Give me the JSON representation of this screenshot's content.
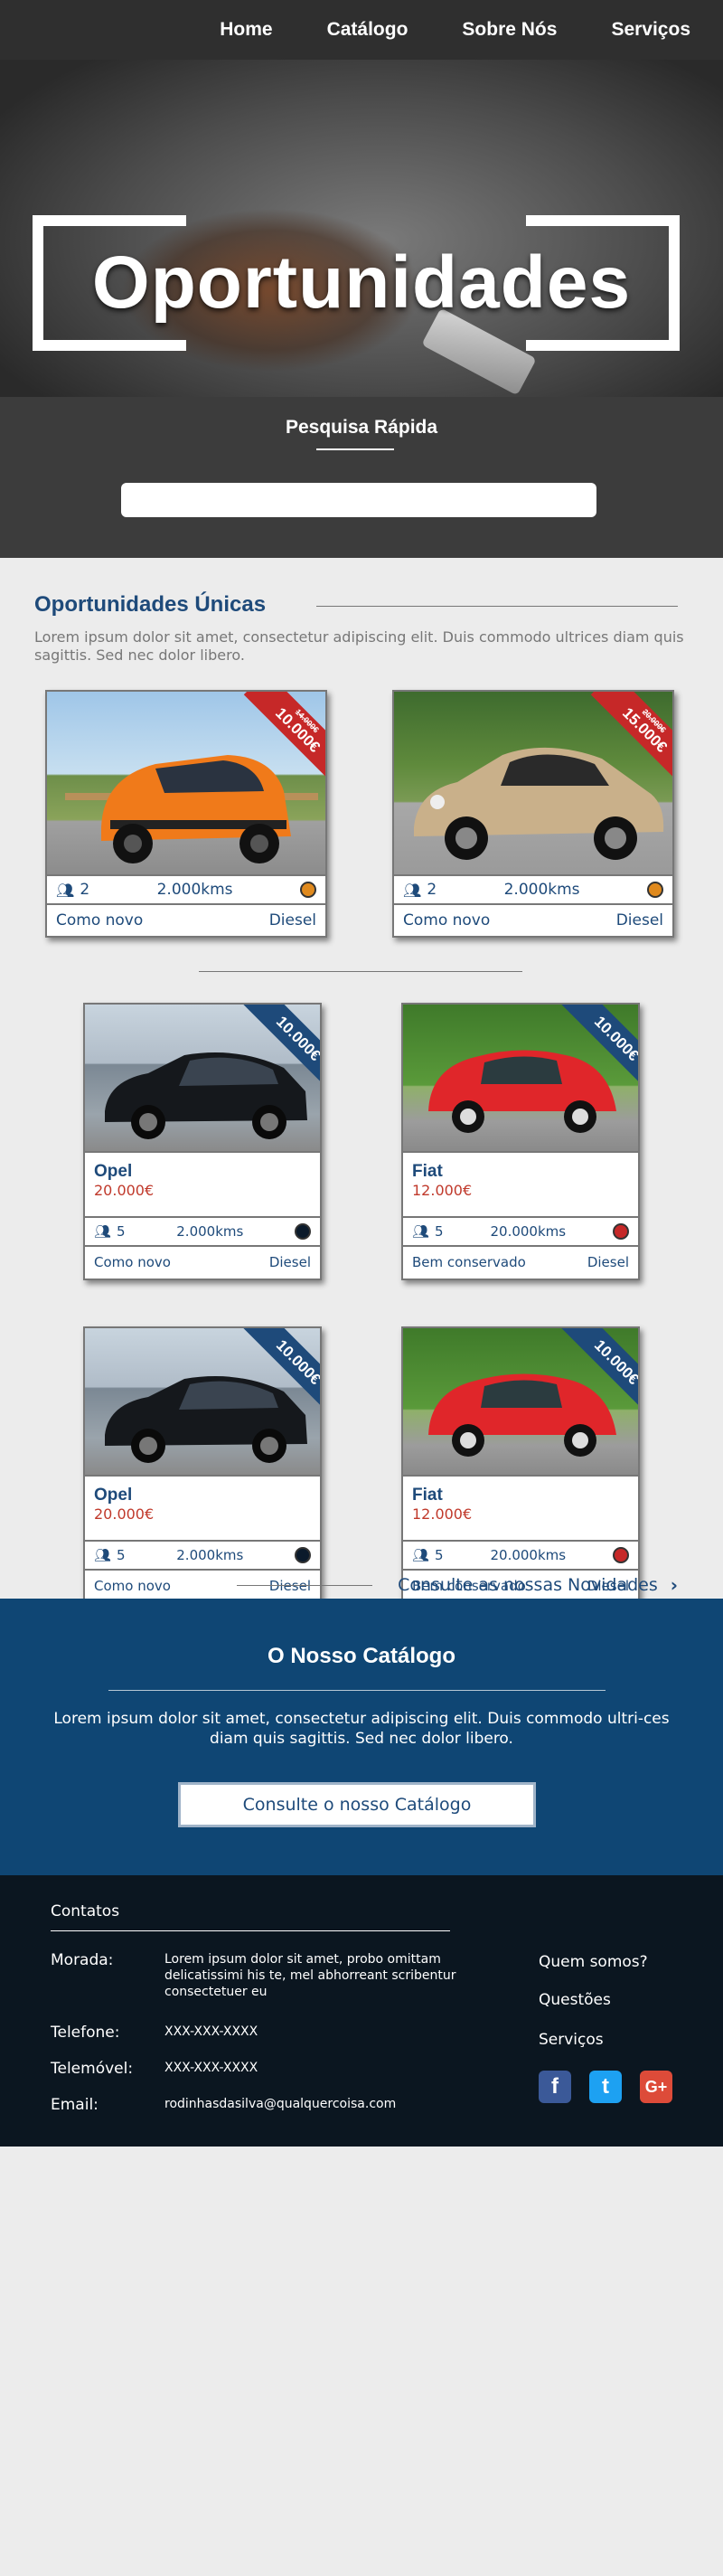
{
  "nav": {
    "items": [
      "Home",
      "Catálogo",
      "Sobre Nós",
      "Serviços"
    ]
  },
  "hero": {
    "title": "Oportunidades"
  },
  "quick_search": {
    "title": "Pesquisa Rápida",
    "value": "",
    "placeholder": ""
  },
  "unique": {
    "title": "Oportunidades Únicas",
    "intro": "Lorem ipsum dolor sit amet, consectetur adipiscing elit. Duis commodo ultrices diam quis sagittis. Sed nec dolor libero.",
    "cards": [
      {
        "ribbon_price": "10.000€",
        "ribbon_old": "14.000€",
        "ribbon_color": "#c62828",
        "seats": "2",
        "km": "2.000kms",
        "dot_color": "#e08a1e",
        "condition": "Como novo",
        "fuel": "Diesel"
      },
      {
        "ribbon_price": "15.000€",
        "ribbon_old": "20.000€",
        "ribbon_color": "#c62828",
        "seats": "2",
        "km": "2.000kms",
        "dot_color": "#e08a1e",
        "condition": "Como novo",
        "fuel": "Diesel"
      }
    ]
  },
  "grid": {
    "cards": [
      {
        "ribbon_price": "10.000€",
        "ribbon_color": "#1e4a7a",
        "brand": "Opel",
        "price": "20.000€",
        "seats": "5",
        "km": "2.000kms",
        "dot_color": "#0b1a2b",
        "condition": "Como novo",
        "fuel": "Diesel"
      },
      {
        "ribbon_price": "10.000€",
        "ribbon_color": "#1e4a7a",
        "brand": "Fiat",
        "price": "12.000€",
        "seats": "5",
        "km": "20.000kms",
        "dot_color": "#c62828",
        "condition": "Bem conservado",
        "fuel": "Diesel"
      },
      {
        "ribbon_price": "10.000€",
        "ribbon_color": "#1e4a7a",
        "brand": "Opel",
        "price": "20.000€",
        "seats": "5",
        "km": "2.000kms",
        "dot_color": "#0b1a2b",
        "condition": "Como novo",
        "fuel": "Diesel"
      },
      {
        "ribbon_price": "10.000€",
        "ribbon_color": "#1e4a7a",
        "brand": "Fiat",
        "price": "12.000€",
        "seats": "5",
        "km": "20.000kms",
        "dot_color": "#c62828",
        "condition": "Bem conservado",
        "fuel": "Diesel"
      },
      {
        "ribbon_price": "10.000€",
        "ribbon_color": "#1e4a7a",
        "brand": "Opel",
        "price": "20.000€",
        "seats": "5",
        "km": "2.000kms",
        "dot_color": "#0b1a2b",
        "condition": "Como novo",
        "fuel": "Diesel"
      },
      {
        "ribbon_price": "10.000€",
        "ribbon_color": "#1e4a7a",
        "brand": "Fiat",
        "price": "12.000€",
        "seats": "5",
        "km": "20.000kms",
        "dot_color": "#c62828",
        "condition": "Bem conservado",
        "fuel": "Diesel"
      }
    ]
  },
  "news_link": {
    "label": "Consulte as nossas Novidades",
    "icon": "chevron-right-icon"
  },
  "catalog": {
    "title": "O Nosso Catálogo",
    "text": "Lorem ipsum dolor sit amet, consectetur adipiscing elit. Duis commodo ultri-ces diam quis sagittis. Sed nec dolor libero.",
    "button": "Consulte o nosso Catálogo"
  },
  "footer": {
    "contacts_title": "Contatos",
    "morada_label": "Morada:",
    "morada_value": "Lorem ipsum dolor sit amet, probo omittam delicatissimi his te, mel abhorreant scribentur consectetuer eu",
    "telefone_label": "Telefone:",
    "telefone_value": "XXX-XXX-XXXX",
    "telemovel_label": "Telemóvel:",
    "telemovel_value": "XXX-XXX-XXXX",
    "email_label": "Email:",
    "email_value": "rodinhasdasilva@qualquercoisa.com",
    "links": [
      "Quem somos?",
      "Questões",
      "Serviços"
    ],
    "social": [
      {
        "icon": "facebook-icon",
        "glyph": "f",
        "color": "#3b5998"
      },
      {
        "icon": "twitter-icon",
        "glyph": "t",
        "color": "#1da1f2"
      },
      {
        "icon": "google-plus-icon",
        "glyph": "G+",
        "color": "#dd4b39"
      }
    ]
  }
}
